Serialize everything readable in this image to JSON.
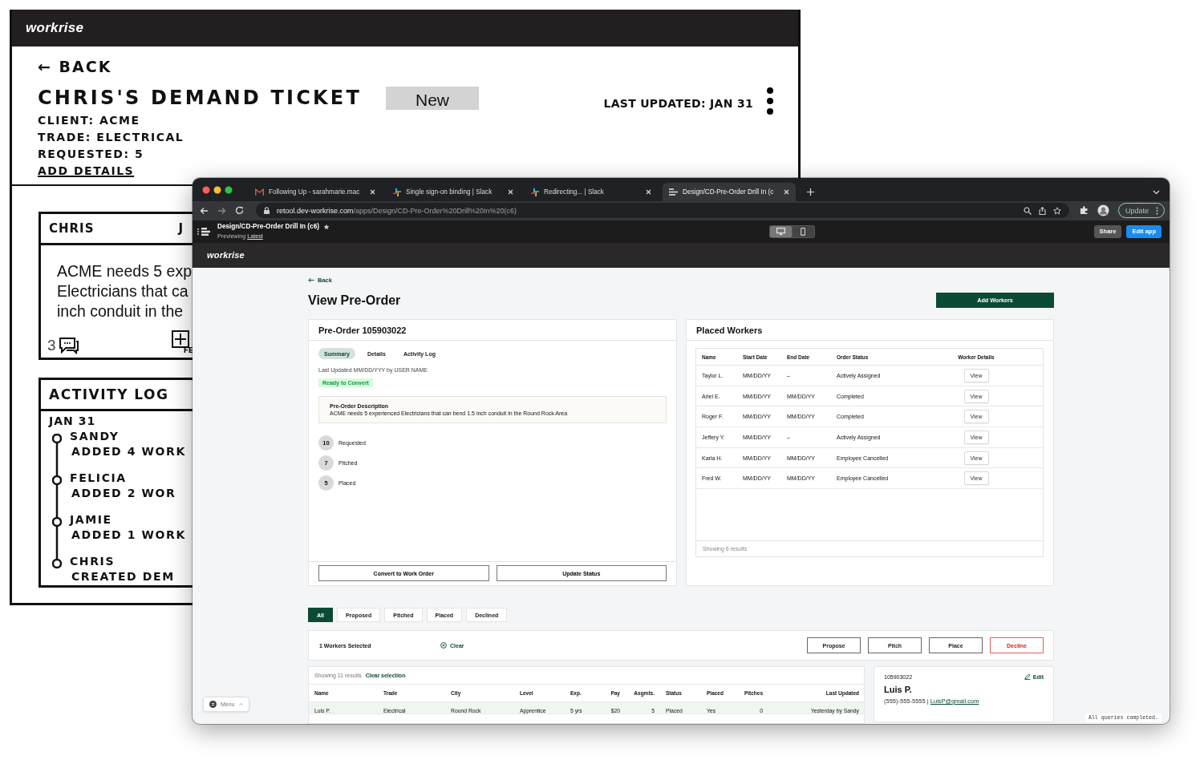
{
  "sketch": {
    "logo": "workrise",
    "back": "← BACK",
    "title": "CHRIS'S DEMAND TICKET",
    "status_badge": "New",
    "last_updated": "LAST UPDATED: JAN 31",
    "fields": [
      "CLIENT: ACME",
      "TRADE: ELECTRICAL",
      "REQUESTED: 5"
    ],
    "add_details": "ADD DETAILS",
    "comment_card": {
      "author": "CHRIS",
      "date_fragment": "J",
      "body_lines": [
        "ACME needs 5 exp",
        "Electricians that ca",
        "inch conduit in the"
      ],
      "comment_count": "3",
      "footer_fragment": "FE"
    },
    "activity_log": {
      "title": "ACTIVITY LOG",
      "date": "JAN 31",
      "entries": [
        {
          "name": "SANDY",
          "action": "ADDED 4 WORK"
        },
        {
          "name": "FELICIA",
          "action": "ADDED 2 WOR"
        },
        {
          "name": "JAMIE",
          "action": "ADDED 1 WORK"
        },
        {
          "name": "CHRIS",
          "action": "CREATED DEM"
        }
      ]
    }
  },
  "browser": {
    "tabs": [
      {
        "title": "Following Up - sarahmarie.mac",
        "kind": "mail",
        "selected": false
      },
      {
        "title": "Single sign-on binding | Slack",
        "kind": "chat",
        "selected": false
      },
      {
        "title": "Redirecting... | Slack",
        "kind": "chat",
        "selected": false
      },
      {
        "title": "Design/CD-Pre-Order Drill In (c",
        "kind": "app",
        "selected": true
      }
    ],
    "url_domain": "retool.dev-workrise.com",
    "url_path": "/apps/Design/CD-Pre-Order%20Drill%20In%20(c6)",
    "update_button": "Update"
  },
  "retool_bar": {
    "app_name": "Design/CD-Pre-Order Drill In (c6)",
    "previewing": "Previewing",
    "version_link": "Latest",
    "view_modes": [
      {
        "kind": "desktop",
        "selected": true
      },
      {
        "kind": "mobile",
        "selected": false
      }
    ],
    "share": "Share",
    "edit": "Edit app"
  },
  "app": {
    "logo": "workrise",
    "back": "Back",
    "title": "View Pre-Order",
    "add_workers": "Add Workers",
    "preorder": {
      "title": "Pre-Order 105903022",
      "tabs": [
        {
          "label": "Summary",
          "selected": true
        },
        {
          "label": "Details",
          "selected": false
        },
        {
          "label": "Activity Log",
          "selected": false
        }
      ],
      "last_updated": "Last Updated MM/DD/YYY by USER NAME",
      "status_tag": "Ready to Convert",
      "description_title": "Pre-Order Description",
      "description": "ACME needs 5 experienced Electricians that can bend 1.5 inch conduit in the Round Rock Area",
      "stats": [
        {
          "count": "10",
          "label": "Requested"
        },
        {
          "count": "7",
          "label": "Pitched"
        },
        {
          "count": "5",
          "label": "Placed"
        }
      ],
      "buttons": [
        "Convert to Work Order",
        "Update Status"
      ]
    },
    "placed_workers": {
      "title": "Placed Workers",
      "columns": [
        "Name",
        "Start Date",
        "End Date",
        "Order Status",
        "Worker Details"
      ],
      "rows": [
        {
          "name": "Taylor L.",
          "start": "MM/DD/YY",
          "end": "–",
          "status": "Actively Assigned",
          "action": "View"
        },
        {
          "name": "Ariel E.",
          "start": "MM/DD/YY",
          "end": "MM/DD/YY",
          "status": "Completed",
          "action": "View"
        },
        {
          "name": "Roger F.",
          "start": "MM/DD/YY",
          "end": "MM/DD/YY",
          "status": "Completed",
          "action": "View"
        },
        {
          "name": "Jeffery Y.",
          "start": "MM/DD/YY",
          "end": "–",
          "status": "Actively Assigned",
          "action": "View"
        },
        {
          "name": "Karla H.",
          "start": "MM/DD/YY",
          "end": "MM/DD/YY",
          "status": "Employee Cancelled",
          "action": "View"
        },
        {
          "name": "Fred W.",
          "start": "MM/DD/YY",
          "end": "MM/DD/YY",
          "status": "Employee Cancelled",
          "action": "View"
        }
      ],
      "footer": "Showing 6 results"
    },
    "filters": [
      {
        "label": "All",
        "selected": true
      },
      {
        "label": "Proposed",
        "selected": false
      },
      {
        "label": "Pitched",
        "selected": false
      },
      {
        "label": "Placed",
        "selected": false
      },
      {
        "label": "Declined",
        "selected": false
      }
    ],
    "selection": {
      "count": "1 Workers Selected",
      "clear": "Clear",
      "actions": [
        {
          "label": "Propose",
          "kind": "normal"
        },
        {
          "label": "Pitch",
          "kind": "normal"
        },
        {
          "label": "Place",
          "kind": "normal"
        },
        {
          "label": "Decline",
          "kind": "danger"
        }
      ]
    },
    "results": {
      "showing": "Showing 11 results",
      "clear_selection": "Clear selection",
      "columns": [
        "Name",
        "Trade",
        "City",
        "Level",
        "Exp.",
        "Pay",
        "Asgmts.",
        "Status",
        "Placed",
        "Pitches",
        "Last Updated"
      ],
      "rows": [
        {
          "selected": true,
          "cells": [
            "Luis P.",
            "Electrical",
            "Round Rock",
            "Apprentice",
            "5 yrs",
            "$20",
            "5",
            "Placed",
            "Yes",
            "0",
            "Yesterday by Sandy"
          ]
        }
      ]
    },
    "worker_card": {
      "id": "105903022",
      "edit": "Edit",
      "name": "Luis P.",
      "phone": "(555)-555-5555 |",
      "email": "LuisP@gmail.com"
    },
    "menu": "Menu",
    "status": "All queries completed."
  }
}
